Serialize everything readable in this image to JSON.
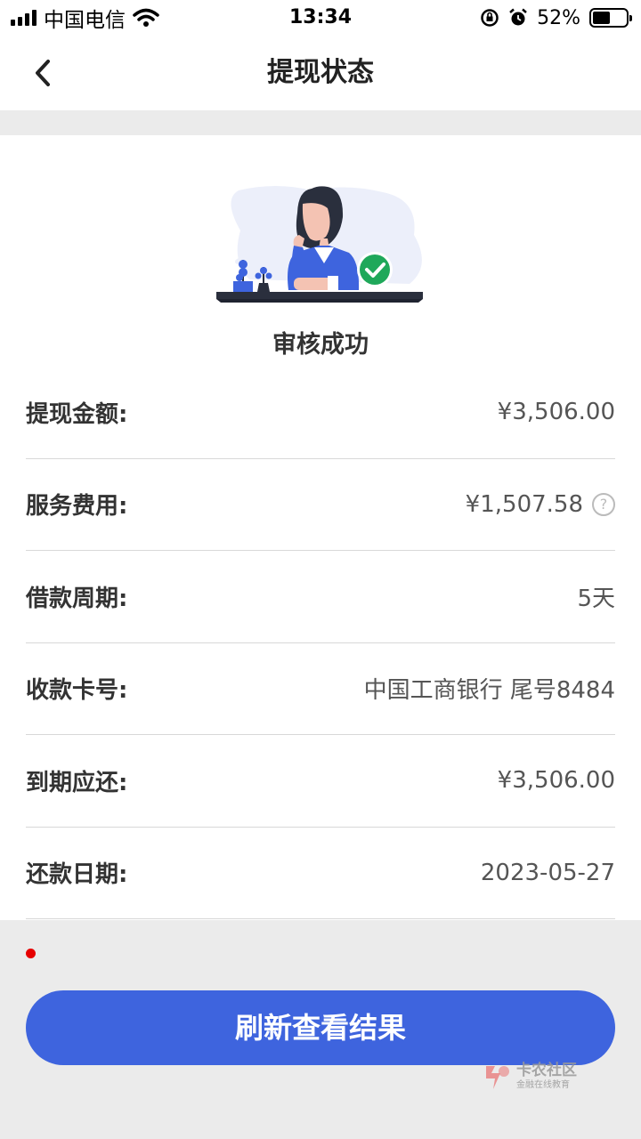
{
  "status_bar": {
    "carrier": "中国电信",
    "time": "13:34",
    "battery": "52%",
    "battery_level": 0.52
  },
  "nav": {
    "title": "提现状态",
    "back_icon": "chevron-left-icon"
  },
  "result": {
    "status_text": "审核成功",
    "status_icon": "check-circle-icon",
    "accent_color": "#1fa85a"
  },
  "details": [
    {
      "label": "提现金额:",
      "value": "¥3,506.00"
    },
    {
      "label": "服务费用:",
      "value": "¥1,507.58",
      "help_icon": "?"
    },
    {
      "label": "借款周期:",
      "value": "5天"
    },
    {
      "label": "收款卡号:",
      "value": "中国工商银行 尾号8484"
    },
    {
      "label": "到期应还:",
      "value": "¥3,506.00"
    },
    {
      "label": "还款日期:",
      "value": "2023-05-27"
    }
  ],
  "refresh_button": {
    "label": "刷新查看结果",
    "color": "#3e64de"
  },
  "watermark": {
    "title": "卡农社区",
    "subtitle": "金融在线教育"
  }
}
